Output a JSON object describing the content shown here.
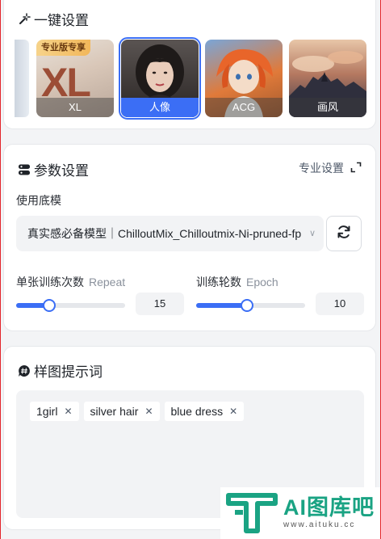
{
  "quick": {
    "title": "一键设置",
    "presets": [
      {
        "label": "XL",
        "badge": "专业版专享",
        "selected": false
      },
      {
        "label": "人像",
        "selected": true
      },
      {
        "label": "ACG",
        "selected": false
      },
      {
        "label": "画风",
        "selected": false
      }
    ]
  },
  "params": {
    "title": "参数设置",
    "pro_settings": "专业设置",
    "base_model_label": "使用底模",
    "base_model_value": "真实感必备模型｜ChilloutMix_Chilloutmix-Ni-pruned-fp",
    "repeat": {
      "label": "单张训练次数",
      "sub": "Repeat",
      "value": "15",
      "fraction": 0.3
    },
    "epoch": {
      "label": "训练轮数",
      "sub": "Epoch",
      "value": "10",
      "fraction": 0.47
    }
  },
  "prompt": {
    "title": "样图提示词",
    "tags": [
      "1girl",
      "silver hair",
      "blue dress"
    ]
  },
  "watermark": {
    "title": "AI图库吧",
    "url": "www.aituku.cc"
  },
  "colors": {
    "accent": "#3b6ef5",
    "watermark": "#1aa383"
  }
}
